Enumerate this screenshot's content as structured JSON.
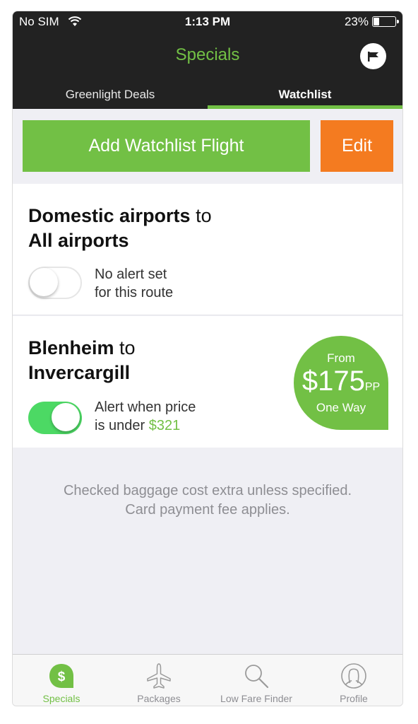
{
  "status_bar": {
    "carrier": "No SIM",
    "time": "1:13 PM",
    "battery": "23%"
  },
  "header": {
    "title": "Specials"
  },
  "tabs": [
    {
      "label": "Greenlight Deals"
    },
    {
      "label": "Watchlist"
    }
  ],
  "actions": {
    "add_label": "Add Watchlist Flight",
    "edit_label": "Edit"
  },
  "watchlist": [
    {
      "origin": "Domestic airports",
      "connector": " to",
      "destination": "All airports",
      "alert_line1": "No alert set",
      "alert_line2": "for this route",
      "alert_enabled": false
    },
    {
      "origin": "Blenheim",
      "connector": " to",
      "destination": "Invercargill",
      "alert_line1": "Alert when price",
      "alert_line2_prefix": "is under ",
      "alert_price": "$321",
      "alert_enabled": true,
      "deal": {
        "from": "From",
        "price": "$175",
        "unit": "PP",
        "trip": "One Way"
      }
    }
  ],
  "disclaimer": {
    "line1": "Checked baggage cost extra unless specified.",
    "line2": "Card payment fee applies."
  },
  "tabbar": [
    {
      "label": "Specials",
      "icon": "dollar-icon",
      "active": true
    },
    {
      "label": "Packages",
      "icon": "plane-icon",
      "active": false
    },
    {
      "label": "Low Fare Finder",
      "icon": "search-icon",
      "active": false
    },
    {
      "label": "Profile",
      "icon": "profile-icon",
      "active": false
    }
  ],
  "colors": {
    "accent": "#72c045",
    "edit": "#f47b20",
    "header_bg": "#222222",
    "toggle_on": "#4cd964"
  }
}
